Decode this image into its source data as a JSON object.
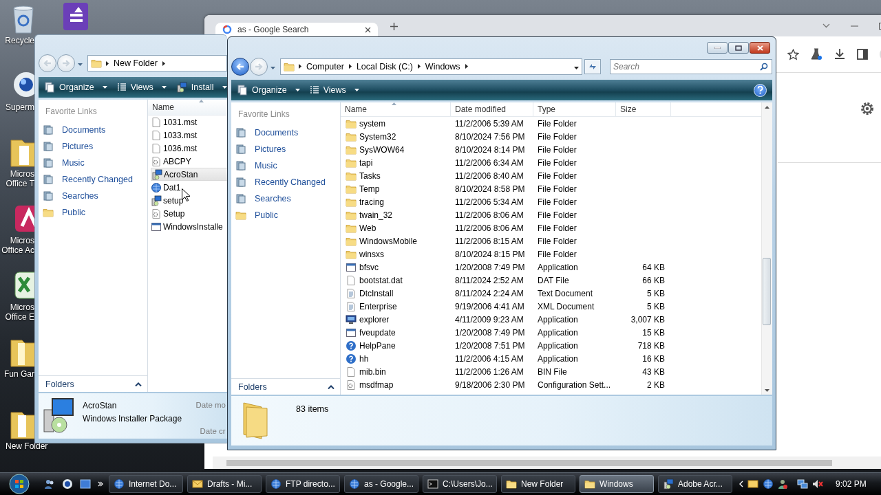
{
  "desktop_icons": [
    {
      "lines": [
        "Recycle"
      ]
    },
    {
      "lines": [
        "Superm"
      ]
    },
    {
      "lines": [
        "Micros",
        "Office T"
      ]
    },
    {
      "lines": [
        "Micros",
        "Office Ac"
      ]
    },
    {
      "lines": [
        "Micros",
        "Office E"
      ]
    },
    {
      "lines": [
        "Fun Gar"
      ]
    },
    {
      "lines": [
        "New Folder"
      ]
    }
  ],
  "browser_window": {
    "tab_title": "as - Google Search"
  },
  "back_explorer_window": {
    "address": [
      "New Folder"
    ],
    "toolbar": [
      "Organize",
      "Views",
      "Install"
    ],
    "favorite_links_heading": "Favorite Links",
    "favorite_links": [
      {
        "label": "Documents",
        "kind": "library"
      },
      {
        "label": "Pictures",
        "kind": "library"
      },
      {
        "label": "Music",
        "kind": "library"
      },
      {
        "label": "Recently Changed",
        "kind": "library"
      },
      {
        "label": "Searches",
        "kind": "library"
      },
      {
        "label": "Public",
        "kind": "folder"
      }
    ],
    "columns": [
      "Name"
    ],
    "files": [
      {
        "name": "1031.mst",
        "kind": "file",
        "selected": false
      },
      {
        "name": "1033.mst",
        "kind": "file",
        "selected": false
      },
      {
        "name": "1036.mst",
        "kind": "file",
        "selected": false
      },
      {
        "name": "ABCPY",
        "kind": "config",
        "selected": false
      },
      {
        "name": "AcroStan",
        "kind": "installer",
        "selected": true
      },
      {
        "name": "Dat1",
        "kind": "globe",
        "selected": false
      },
      {
        "name": "setup",
        "kind": "installer",
        "selected": false
      },
      {
        "name": "Setup",
        "kind": "config",
        "selected": false
      },
      {
        "name": "WindowsInstalle",
        "kind": "application",
        "selected": false
      }
    ],
    "folders_label": "Folders",
    "details": {
      "name": "AcroStan",
      "type": "Windows Installer Package",
      "labels": [
        "Date mo",
        "Date cr"
      ]
    }
  },
  "front_explorer_window": {
    "address": [
      "Computer",
      "Local Disk (C:)",
      "Windows"
    ],
    "search_placeholder": "Search",
    "toolbar": [
      "Organize",
      "Views"
    ],
    "favorite_links_heading": "Favorite Links",
    "favorite_links": [
      {
        "label": "Documents",
        "kind": "library"
      },
      {
        "label": "Pictures",
        "kind": "library"
      },
      {
        "label": "Music",
        "kind": "library"
      },
      {
        "label": "Recently Changed",
        "kind": "library"
      },
      {
        "label": "Searches",
        "kind": "library"
      },
      {
        "label": "Public",
        "kind": "folder"
      }
    ],
    "columns": [
      "Name",
      "Date modified",
      "Type",
      "Size"
    ],
    "rows": [
      {
        "kind": "folder",
        "name": "system",
        "date": "11/2/2006 5:39 AM",
        "type": "File Folder"
      },
      {
        "kind": "folder",
        "name": "System32",
        "date": "8/10/2024 7:56 PM",
        "type": "File Folder"
      },
      {
        "kind": "folder",
        "name": "SysWOW64",
        "date": "8/10/2024 8:14 PM",
        "type": "File Folder"
      },
      {
        "kind": "folder",
        "name": "tapi",
        "date": "11/2/2006 6:34 AM",
        "type": "File Folder"
      },
      {
        "kind": "folder",
        "name": "Tasks",
        "date": "11/2/2006 8:40 AM",
        "type": "File Folder"
      },
      {
        "kind": "folder",
        "name": "Temp",
        "date": "8/10/2024 8:58 PM",
        "type": "File Folder"
      },
      {
        "kind": "folder",
        "name": "tracing",
        "date": "11/2/2006 5:34 AM",
        "type": "File Folder"
      },
      {
        "kind": "folder",
        "name": "twain_32",
        "date": "11/2/2006 8:06 AM",
        "type": "File Folder"
      },
      {
        "kind": "folder",
        "name": "Web",
        "date": "11/2/2006 8:06 AM",
        "type": "File Folder"
      },
      {
        "kind": "folder",
        "name": "WindowsMobile",
        "date": "11/2/2006 8:15 AM",
        "type": "File Folder"
      },
      {
        "kind": "folder",
        "name": "winsxs",
        "date": "8/10/2024 8:15 PM",
        "type": "File Folder"
      },
      {
        "kind": "application",
        "name": "bfsvc",
        "date": "1/20/2008 7:49 PM",
        "type": "Application",
        "size": "64 KB"
      },
      {
        "kind": "file",
        "name": "bootstat.dat",
        "date": "8/11/2024 2:52 AM",
        "type": "DAT File",
        "size": "66 KB"
      },
      {
        "kind": "document",
        "name": "DtcInstall",
        "date": "8/11/2024 2:24 AM",
        "type": "Text Document",
        "size": "5 KB"
      },
      {
        "kind": "document",
        "name": "Enterprise",
        "date": "9/19/2006 4:41 AM",
        "type": "XML Document",
        "size": "5 KB"
      },
      {
        "kind": "computer",
        "name": "explorer",
        "date": "4/11/2009 9:23 AM",
        "type": "Application",
        "size": "3,007 KB"
      },
      {
        "kind": "application",
        "name": "fveupdate",
        "date": "1/20/2008 7:49 PM",
        "type": "Application",
        "size": "15 KB"
      },
      {
        "kind": "help",
        "name": "HelpPane",
        "date": "1/20/2008 7:51 PM",
        "type": "Application",
        "size": "718 KB"
      },
      {
        "kind": "help",
        "name": "hh",
        "date": "11/2/2006 4:15 AM",
        "type": "Application",
        "size": "16 KB"
      },
      {
        "kind": "file",
        "name": "mib.bin",
        "date": "11/2/2006 1:26 AM",
        "type": "BIN File",
        "size": "43 KB"
      },
      {
        "kind": "config",
        "name": "msdfmap",
        "date": "9/18/2006 2:30 PM",
        "type": "Configuration Sett...",
        "size": "2 KB"
      }
    ],
    "folders_label": "Folders",
    "status": "83 items"
  },
  "taskbar": {
    "buttons": [
      {
        "label": "Internet Do...",
        "selected": false
      },
      {
        "label": "Drafts - Mi...",
        "selected": false
      },
      {
        "label": "FTP directo...",
        "selected": false
      },
      {
        "label": "as - Google...",
        "selected": false
      },
      {
        "label": "C:\\Users\\Jo...",
        "selected": false
      },
      {
        "label": "New Folder",
        "selected": false
      },
      {
        "label": "Windows",
        "selected": true
      },
      {
        "label": "Adobe Acr...",
        "selected": false
      }
    ],
    "clock": "9:02 PM"
  }
}
